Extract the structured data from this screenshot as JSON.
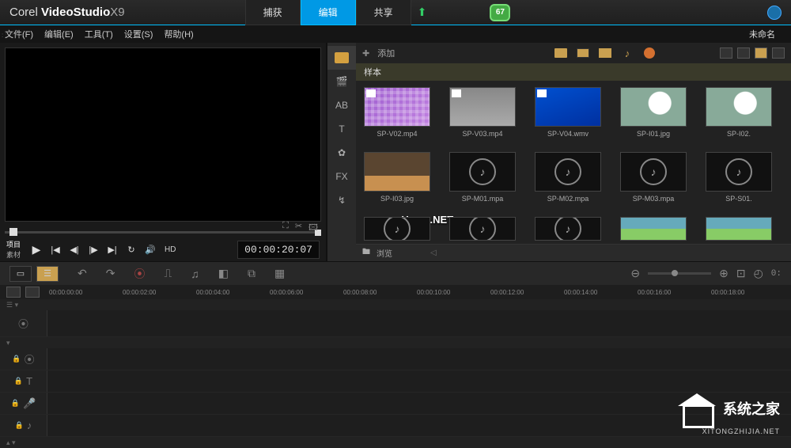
{
  "app": {
    "brand_pre": "Corel",
    "brand_main": "VideoStudio",
    "version": "X9"
  },
  "top_tabs": {
    "capture": "捕获",
    "edit": "编辑",
    "share": "共享"
  },
  "badge": "67",
  "menu": {
    "file": "文件(F)",
    "edit": "编辑(E)",
    "tools": "工具(T)",
    "settings": "设置(S)",
    "help": "帮助(H)"
  },
  "project_name": "未命名",
  "preview": {
    "mode_project": "项目",
    "mode_clip": "素材",
    "hd": "HD",
    "timecode": "00:00:20:07"
  },
  "library": {
    "add": "添加",
    "folder": "样本",
    "browse": "浏览",
    "thumbs": [
      {
        "name": "SP-V02.mp4",
        "style": "purple",
        "tag": "▦"
      },
      {
        "name": "SP-V03.mp4",
        "style": "gray",
        "tag": "▦"
      },
      {
        "name": "SP-V04.wmv",
        "style": "blue",
        "tag": "▦"
      },
      {
        "name": "SP-I01.jpg",
        "style": "dandelion",
        "tag": ""
      },
      {
        "name": "SP-I02.",
        "style": "dandelion",
        "tag": ""
      },
      {
        "name": "SP-I03.jpg",
        "style": "desert",
        "tag": ""
      },
      {
        "name": "SP-M01.mpa",
        "style": "music",
        "tag": ""
      },
      {
        "name": "SP-M02.mpa",
        "style": "music",
        "tag": ""
      },
      {
        "name": "SP-M03.mpa",
        "style": "music",
        "tag": ""
      },
      {
        "name": "SP-S01.",
        "style": "music",
        "tag": ""
      }
    ]
  },
  "sidebar_tabs": {
    "ab": "AB",
    "t": "T",
    "fx": "FX"
  },
  "ruler": [
    "00:00:00:00",
    "00:00:02:00",
    "00:00:04:00",
    "00:00:06:00",
    "00:00:08:00",
    "00:00:10:00",
    "00:00:12:00",
    "00:00:14:00",
    "00:00:16:00",
    "00:00:18:00"
  ],
  "watermark_phome": "www.pHome.NET",
  "watermark_site": {
    "cn": "系统之家",
    "en": "XITONGZHIJIA.NET"
  }
}
